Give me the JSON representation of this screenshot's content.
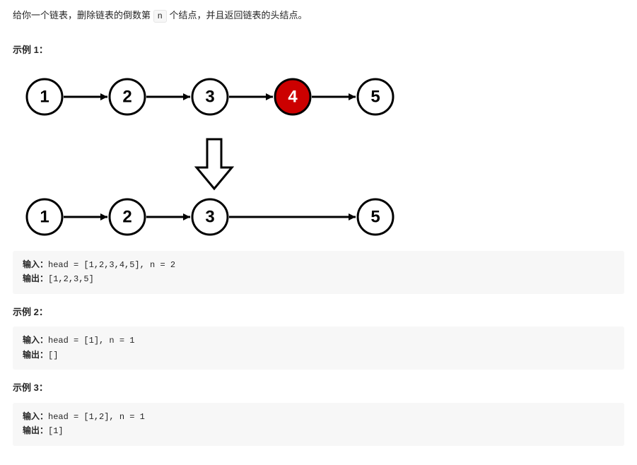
{
  "intro_pre": "给你一个链表，删除链表的倒数第 ",
  "intro_code": "n",
  "intro_post": " 个结点，并且返回链表的头结点。",
  "example1": {
    "title": "示例 1：",
    "input_label": "输入：",
    "input_value": "head = [1,2,3,4,5], n = 2",
    "output_label": "输出：",
    "output_value": "[1,2,3,5]"
  },
  "example2": {
    "title": "示例 2：",
    "input_label": "输入：",
    "input_value": "head = [1], n = 1",
    "output_label": "输出：",
    "output_value": "[]"
  },
  "example3": {
    "title": "示例 3：",
    "input_label": "输入：",
    "input_value": "head = [1,2], n = 1",
    "output_label": "输出：",
    "output_value": "[1]"
  },
  "diagram": {
    "top_row": [
      {
        "v": "1",
        "fill": "#fff",
        "text": "#000"
      },
      {
        "v": "2",
        "fill": "#fff",
        "text": "#000"
      },
      {
        "v": "3",
        "fill": "#fff",
        "text": "#000"
      },
      {
        "v": "4",
        "fill": "#cc0000",
        "text": "#fff"
      },
      {
        "v": "5",
        "fill": "#fff",
        "text": "#000"
      }
    ],
    "bottom_row": [
      {
        "v": "1"
      },
      {
        "v": "2"
      },
      {
        "v": "3"
      },
      {
        "v": "5"
      }
    ]
  }
}
